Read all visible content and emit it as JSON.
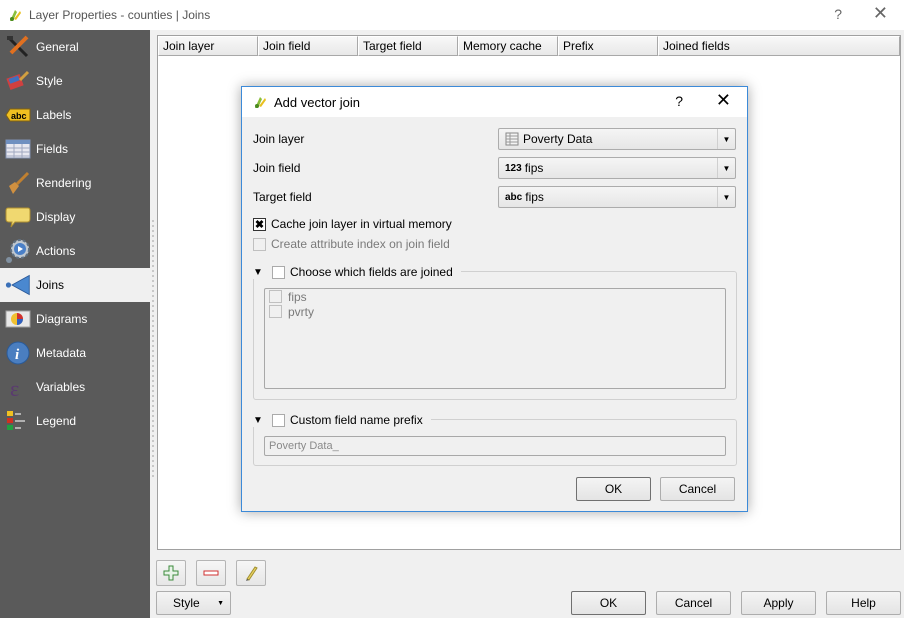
{
  "window": {
    "title": "Layer Properties - counties | Joins",
    "help_glyph": "?",
    "close_glyph": "✕"
  },
  "sidebar": {
    "items": [
      {
        "label": "General",
        "icon": "tools-icon",
        "active": false
      },
      {
        "label": "Style",
        "icon": "paintbrush-icon",
        "active": false
      },
      {
        "label": "Labels",
        "icon": "abc-label-icon",
        "active": false
      },
      {
        "label": "Fields",
        "icon": "table-icon",
        "active": false
      },
      {
        "label": "Rendering",
        "icon": "brush-icon",
        "active": false
      },
      {
        "label": "Display",
        "icon": "speech-bubble-icon",
        "active": false
      },
      {
        "label": "Actions",
        "icon": "gear-play-icon",
        "active": false
      },
      {
        "label": "Joins",
        "icon": "join-arrow-icon",
        "active": true
      },
      {
        "label": "Diagrams",
        "icon": "pie-diagram-icon",
        "active": false
      },
      {
        "label": "Metadata",
        "icon": "info-icon",
        "active": false
      },
      {
        "label": "Variables",
        "icon": "epsilon-icon",
        "active": false
      },
      {
        "label": "Legend",
        "icon": "legend-icon",
        "active": false
      }
    ]
  },
  "joins_table": {
    "columns": [
      "Join layer",
      "Join field",
      "Target field",
      "Memory cache",
      "Prefix",
      "Joined fields"
    ],
    "rows": []
  },
  "toolbar": {
    "add_tooltip_icon": "plus-icon",
    "remove_icon": "minus-icon",
    "edit_icon": "pencil-icon",
    "style_label": "Style",
    "style_arrow": "▼"
  },
  "footer": {
    "ok": "OK",
    "cancel": "Cancel",
    "apply": "Apply",
    "help": "Help"
  },
  "dialog": {
    "title": "Add vector join",
    "help_glyph": "?",
    "close_glyph": "✕",
    "join_layer": {
      "label": "Join layer",
      "value": "Poverty Data"
    },
    "join_field": {
      "label": "Join field",
      "type_tag": "123",
      "value": "fips"
    },
    "target_field": {
      "label": "Target field",
      "type_tag": "abc",
      "value": "fips"
    },
    "cache_checkbox": {
      "label": "Cache join layer in virtual memory",
      "checked": true,
      "mark": "✖"
    },
    "index_checkbox": {
      "label": "Create attribute index on join field",
      "checked": false,
      "disabled": true
    },
    "fields_group": {
      "label": "Choose which fields are joined",
      "checked": false,
      "fields": [
        {
          "name": "fips",
          "checked": false
        },
        {
          "name": "pvrty",
          "checked": false
        }
      ]
    },
    "prefix_group": {
      "label": "Custom field name prefix",
      "checked": false,
      "value": "Poverty Data_"
    },
    "ok": "OK",
    "cancel": "Cancel",
    "collapse_glyph": "▼",
    "combo_arrow": "▼"
  },
  "colors": {
    "sidebar_bg": "#5a5a5a",
    "dialog_border": "#3c8ad8",
    "panel_bg": "#f0f0f0"
  }
}
